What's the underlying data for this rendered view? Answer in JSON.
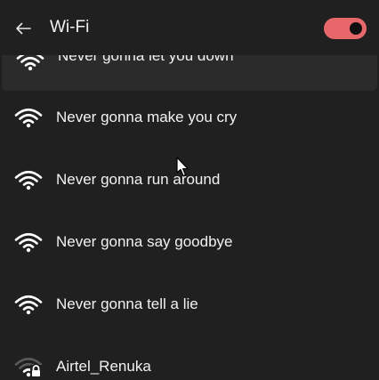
{
  "header": {
    "back_icon": "back-arrow-icon",
    "title": "Wi-Fi",
    "toggle": {
      "state": "on",
      "accent_color": "#e8676a"
    }
  },
  "networks": [
    {
      "name": "Never gonna let you down",
      "signal_icon": "wifi-full-icon",
      "secured": false,
      "highlighted": true
    },
    {
      "name": "Never gonna make you cry",
      "signal_icon": "wifi-full-icon",
      "secured": false,
      "highlighted": false
    },
    {
      "name": "Never gonna run around",
      "signal_icon": "wifi-full-icon",
      "secured": false,
      "highlighted": false
    },
    {
      "name": "Never gonna say goodbye",
      "signal_icon": "wifi-full-icon",
      "secured": false,
      "highlighted": false
    },
    {
      "name": "Never gonna tell a lie",
      "signal_icon": "wifi-full-icon",
      "secured": false,
      "highlighted": false
    },
    {
      "name": "Airtel_Renuka",
      "signal_icon": "wifi-weak-locked-icon",
      "secured": true,
      "highlighted": false
    }
  ],
  "pointer_icon": "mouse-pointer-icon"
}
